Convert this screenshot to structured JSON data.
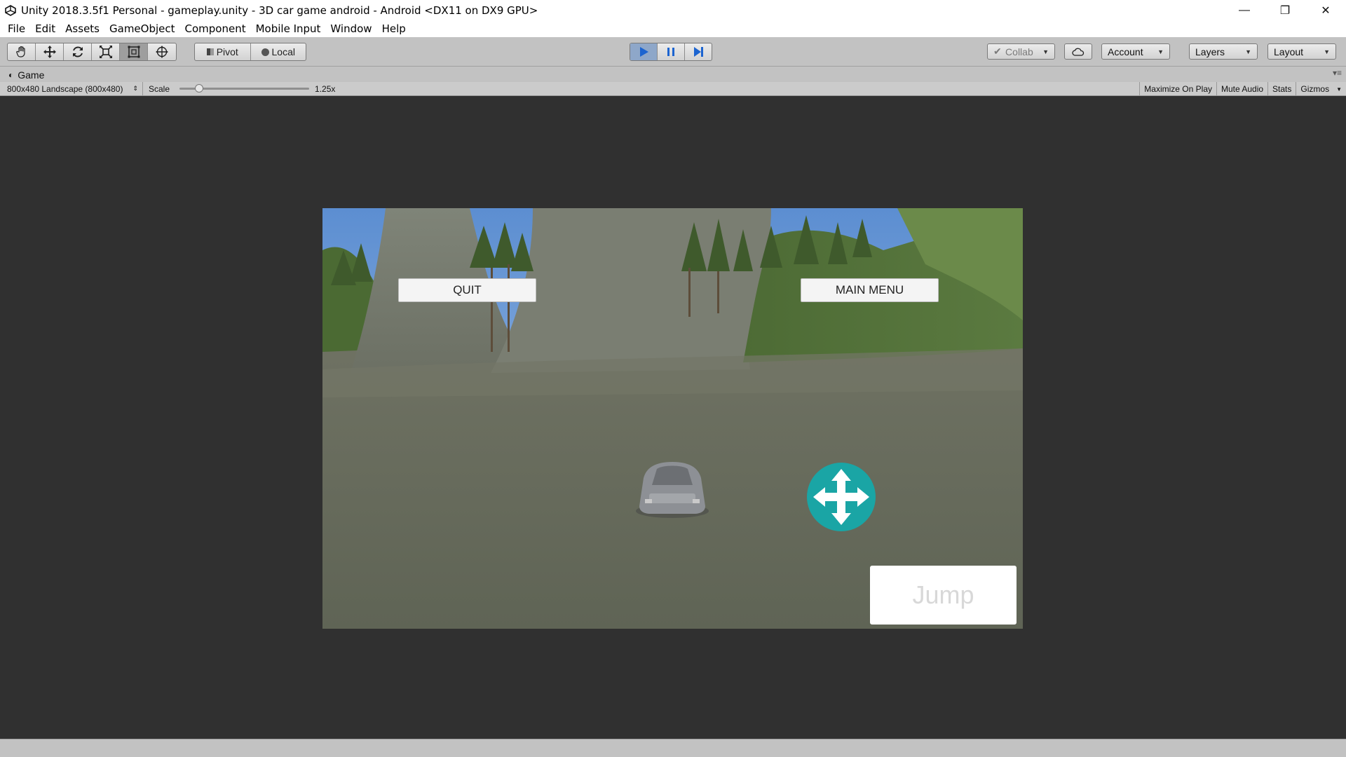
{
  "window": {
    "title": "Unity 2018.3.5f1 Personal - gameplay.unity - 3D car game android - Android <DX11 on DX9 GPU>",
    "controls": {
      "minimize": "—",
      "restore": "❐",
      "close": "✕"
    }
  },
  "menubar": {
    "items": [
      "File",
      "Edit",
      "Assets",
      "GameObject",
      "Component",
      "Mobile Input",
      "Window",
      "Help"
    ]
  },
  "toolbar": {
    "transform_tools": [
      "hand-tool",
      "move-tool",
      "rotate-tool",
      "scale-tool",
      "rect-tool",
      "transform-tool"
    ],
    "pivot_label": "Pivot",
    "local_label": "Local",
    "collab_label": "Collab",
    "account_label": "Account",
    "layers_label": "Layers",
    "layout_label": "Layout"
  },
  "game_panel": {
    "tab_label": "Game",
    "resolution": "800x480 Landscape (800x480)",
    "scale_label": "Scale",
    "scale_value": "1.25x",
    "scale_fraction": 0.08,
    "buttons": [
      "Maximize On Play",
      "Mute Audio",
      "Stats",
      "Gizmos"
    ]
  },
  "game_ui": {
    "quit_label": "QUIT",
    "main_menu_label": "MAIN MENU",
    "jump_label": "Jump",
    "joystick_color": "#1aa5a5"
  },
  "colors": {
    "play_active": "#8ea7c9",
    "editor_bg": "#c2c2c2",
    "game_bg": "#303030"
  }
}
